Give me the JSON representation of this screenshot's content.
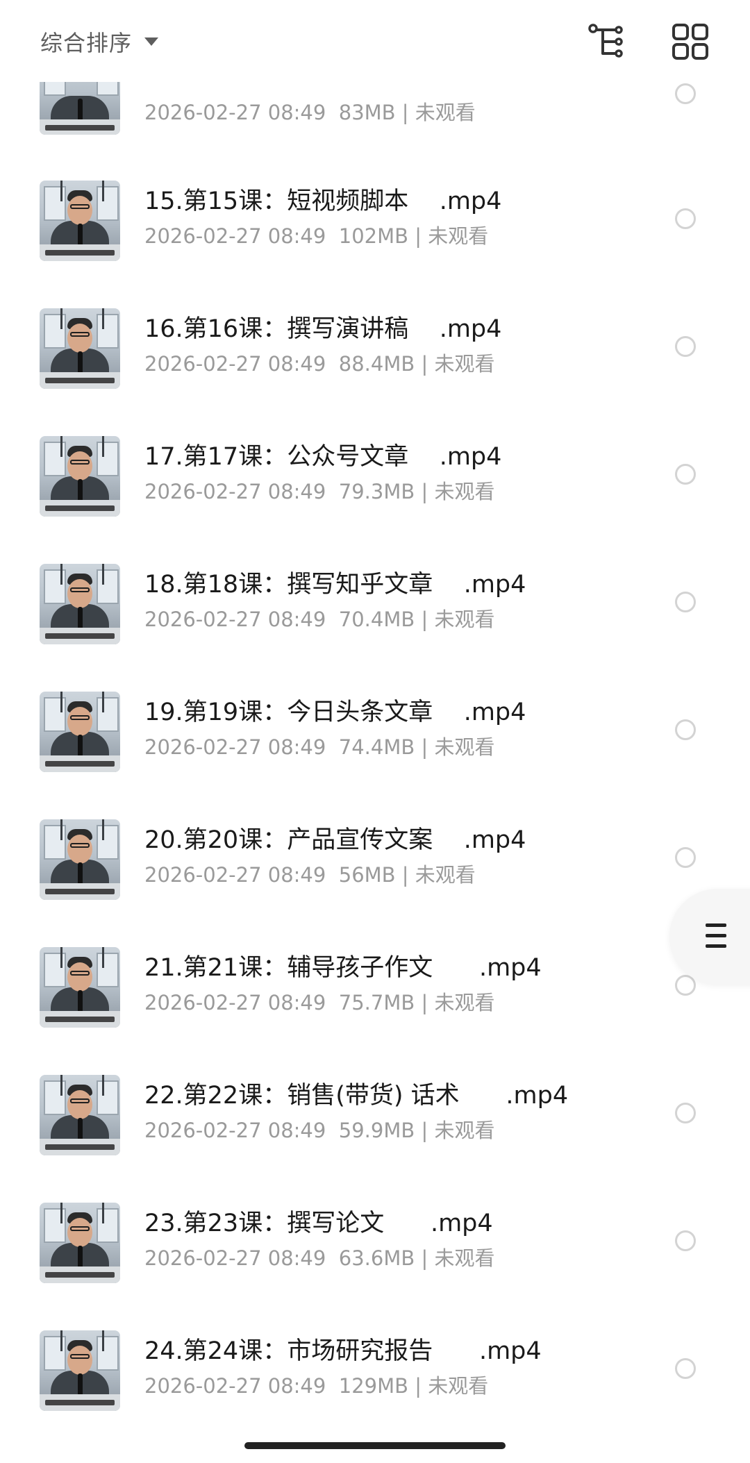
{
  "header": {
    "sort_label": "综合排序",
    "sort_icon": "caret-down-icon",
    "tree_view_icon": "tree-view-icon",
    "grid_view_icon": "grid-view-icon"
  },
  "files": [
    {
      "title": "",
      "meta": "2026-02-27 08:49  83MB | 未观看"
    },
    {
      "title": "15.第15课：短视频脚本    .mp4",
      "meta": "2026-02-27 08:49  102MB | 未观看"
    },
    {
      "title": "16.第16课：撰写演讲稿    .mp4",
      "meta": "2026-02-27 08:49  88.4MB | 未观看"
    },
    {
      "title": "17.第17课：公众号文章    .mp4",
      "meta": "2026-02-27 08:49  79.3MB | 未观看"
    },
    {
      "title": "18.第18课：撰写知乎文章    .mp4",
      "meta": "2026-02-27 08:49  70.4MB | 未观看"
    },
    {
      "title": "19.第19课：今日头条文章    .mp4",
      "meta": "2026-02-27 08:49  74.4MB | 未观看"
    },
    {
      "title": "20.第20课：产品宣传文案    .mp4",
      "meta": "2026-02-27 08:49  56MB | 未观看"
    },
    {
      "title": "21.第21课：辅导孩子作文      .mp4",
      "meta": "2026-02-27 08:49  75.7MB | 未观看"
    },
    {
      "title": "22.第22课：销售(带货) 话术      .mp4",
      "meta": "2026-02-27 08:49  59.9MB | 未观看"
    },
    {
      "title": "23.第23课：撰写论文      .mp4",
      "meta": "2026-02-27 08:49  63.6MB | 未观看"
    },
    {
      "title": "24.第24课：市场研究报告      .mp4",
      "meta": "2026-02-27 08:49  129MB | 未观看"
    }
  ],
  "side_tab": {
    "icon": "menu-lines-icon"
  }
}
